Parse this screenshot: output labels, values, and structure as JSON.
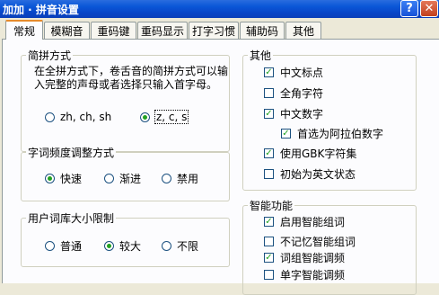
{
  "window": {
    "title": "加加 · 拼音设置",
    "help_label": "?",
    "close_label": "✕"
  },
  "tabs": [
    "常规",
    "模糊音",
    "重码键",
    "重码显示",
    "打字习惯",
    "辅助码",
    "其他"
  ],
  "abbrev": {
    "title": "简拼方式",
    "description": "在全拼方式下，卷舌音的简拼方式可以输入完整的声母或者选择只输入首字母。",
    "options": [
      "zh, ch, sh",
      "z, c, s"
    ],
    "selected": 1
  },
  "freq": {
    "title": "字词频度调整方式",
    "options": [
      "快速",
      "渐进",
      "禁用"
    ],
    "selected": 0
  },
  "userdict": {
    "title": "用户词库大小限制",
    "options": [
      "普通",
      "较大",
      "不限"
    ],
    "selected": 1
  },
  "other": {
    "title": "其他",
    "items": [
      {
        "label": "中文标点",
        "checked": true
      },
      {
        "label": "全角字符",
        "checked": false
      },
      {
        "label": "中文数字",
        "checked": true
      },
      {
        "label": "首选为阿拉伯数字",
        "checked": true
      },
      {
        "label": "使用GBK字符集",
        "checked": true
      },
      {
        "label": "初始为英文状态",
        "checked": false
      }
    ]
  },
  "smart": {
    "title": "智能功能",
    "items": [
      {
        "label": "启用智能组词",
        "checked": true
      },
      {
        "label": "不记忆智能组词",
        "checked": false
      },
      {
        "label": "词组智能调频",
        "checked": true
      },
      {
        "label": "单字智能调频",
        "checked": false
      }
    ]
  }
}
